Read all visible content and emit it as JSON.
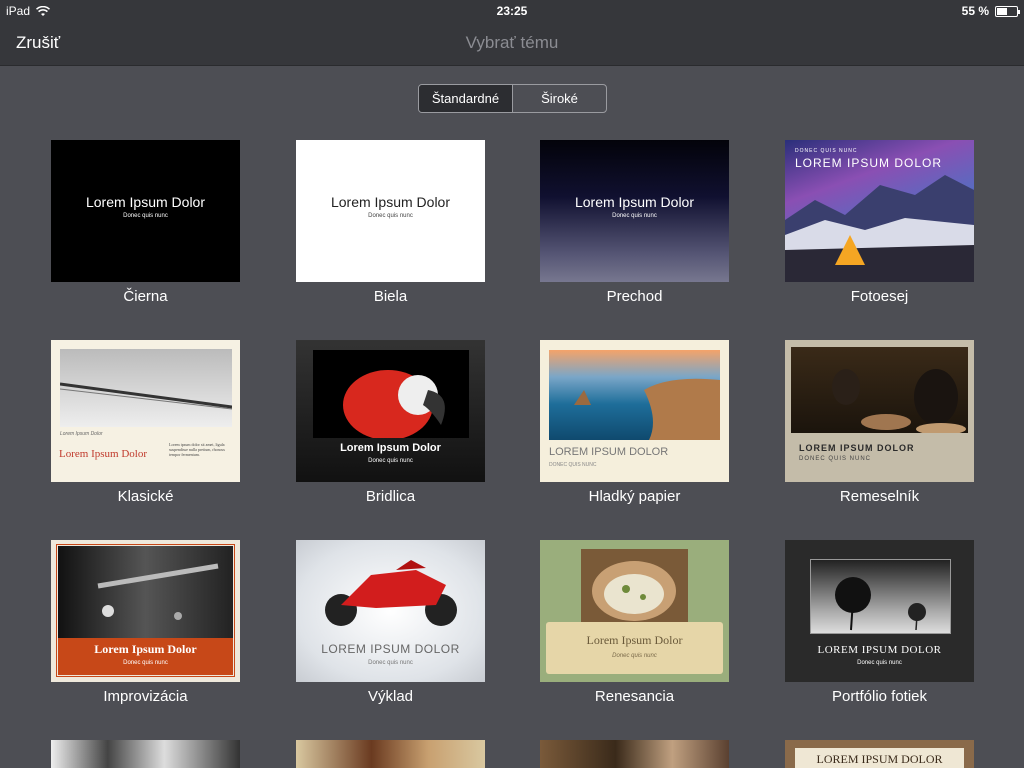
{
  "status": {
    "device": "iPad",
    "time": "23:25",
    "battery": "55 %",
    "battery_level": 0.55
  },
  "nav": {
    "cancel_label": "Zrušiť",
    "title": "Vybrať tému"
  },
  "segmented": {
    "options": [
      "Štandardné",
      "Široké"
    ],
    "selected": "Štandardné"
  },
  "placeholders": {
    "title": "Lorem Ipsum Dolor",
    "title_caps": "LOREM IPSUM DOLOR",
    "subtitle": "Donec quis nunc",
    "subtitle_caps": "DONEC QUIS NUNC",
    "body": "Lorem ipsum dolor sit amet, ligula suspendisse nulla pretium, rhoncus tempor fermentum."
  },
  "themes": [
    {
      "name": "Čierna"
    },
    {
      "name": "Biela"
    },
    {
      "name": "Prechod"
    },
    {
      "name": "Fotoesej"
    },
    {
      "name": "Klasické"
    },
    {
      "name": "Bridlica"
    },
    {
      "name": "Hladký papier"
    },
    {
      "name": "Remeselník"
    },
    {
      "name": "Improvizácia"
    },
    {
      "name": "Výklad"
    },
    {
      "name": "Renesancia"
    },
    {
      "name": "Portfólio fotiek"
    }
  ]
}
